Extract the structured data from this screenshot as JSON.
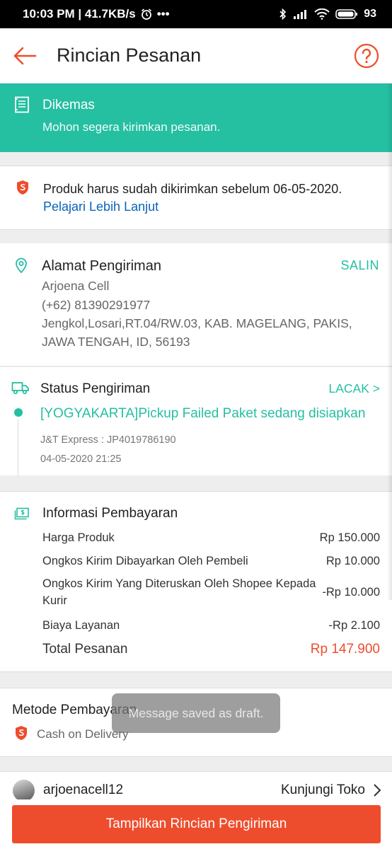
{
  "status_bar": {
    "time_net": "10:03 PM | 41.7KB/s",
    "dots": "•••",
    "battery_pct": "93"
  },
  "header": {
    "title": "Rincian Pesanan"
  },
  "order_status": {
    "title": "Dikemas",
    "message": "Mohon segera kirimkan pesanan."
  },
  "deadline": {
    "text": "Produk harus sudah dikirimkan sebelum 06-05-2020.",
    "link": "Pelajari Lebih Lanjut"
  },
  "address": {
    "title": "Alamat Pengiriman",
    "copy_label": "SALIN",
    "name": "Arjoena Cell",
    "phone": "(+62) 81390291977",
    "line1": "Jengkol,Losari,RT.04/RW.03, KAB. MAGELANG, PAKIS,",
    "line2": "JAWA TENGAH, ID, 56193"
  },
  "shipping": {
    "title": "Status Pengiriman",
    "track_label": "LACAK >",
    "event": "[YOGYAKARTA]Pickup Failed Paket sedang disiapkan",
    "courier": "J&T Express :  JP4019786190",
    "datetime": "04-05-2020 21:25"
  },
  "payment": {
    "title": "Informasi Pembayaran",
    "rows": [
      {
        "label": "Harga Produk",
        "value": "Rp 150.000"
      },
      {
        "label": "Ongkos Kirim Dibayarkan Oleh Pembeli",
        "value": "Rp 10.000"
      },
      {
        "label": "Ongkos Kirim Yang Diteruskan Oleh Shopee Kepada",
        "label2": "Kurir",
        "value": "-Rp 10.000"
      },
      {
        "label": "Biaya Layanan",
        "value": "-Rp 2.100"
      }
    ],
    "total_label": "Total Pesanan",
    "total_value": "Rp 147.900"
  },
  "payment_method": {
    "title": "Metode Pembayaran",
    "value": "Cash on Delivery"
  },
  "seller": {
    "username": "arjoenacell12",
    "visit_label": "Kunjungi Toko"
  },
  "toast": {
    "message": "Message saved as draft."
  },
  "cta": {
    "label": "Tampilkan Rincian Pengiriman"
  },
  "colors": {
    "accent": "#ee4d2d",
    "teal": "#25bfa2",
    "link": "#0b62b8"
  },
  "icons": [
    "back-arrow-icon",
    "help-icon",
    "receipt-icon",
    "shopee-shield-icon",
    "location-pin-icon",
    "truck-icon",
    "payment-icon",
    "chevron-right-icon"
  ]
}
